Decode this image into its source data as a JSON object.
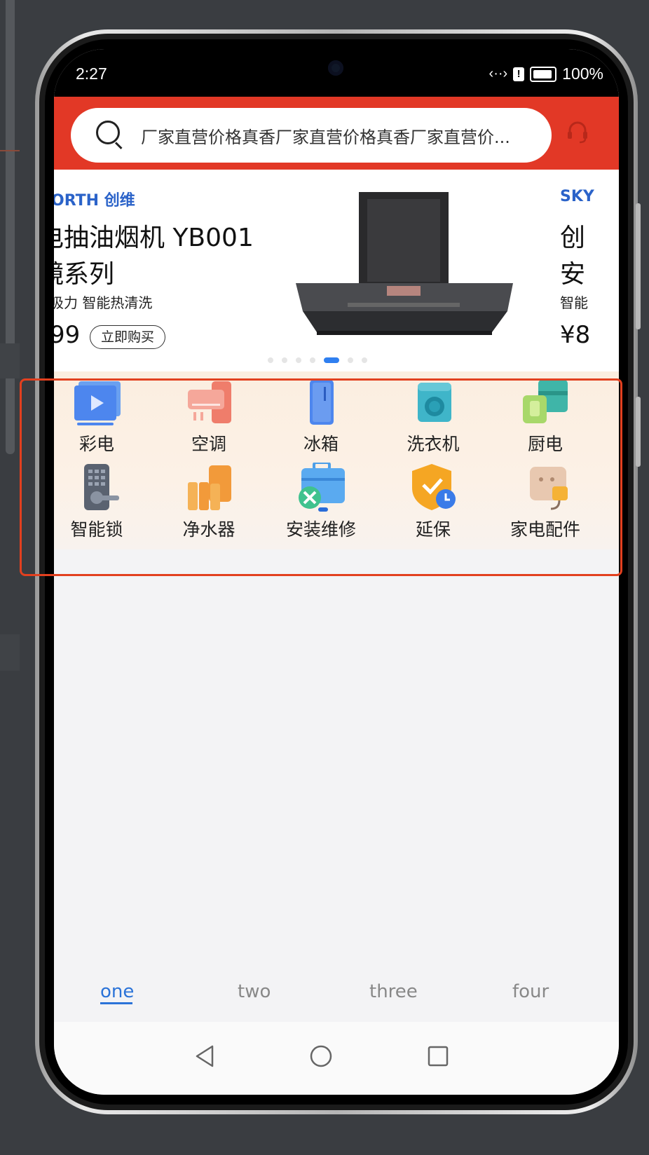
{
  "status_bar": {
    "time": "2:27",
    "battery": "100%"
  },
  "search": {
    "placeholder_text": "厂家直营价格真香厂家直营价格真香厂家直营价..."
  },
  "banner": {
    "left_brand": "ORTH 创维",
    "left_title_line1": "电抽油烟机 YB001",
    "left_title_line2": "镜系列",
    "left_subtitle": "吸力 智能热清洗",
    "left_price": "99",
    "buy_label": "立即购买",
    "right_brand": "SKY",
    "right_title_line1": "创",
    "right_title_line2": "安",
    "right_subtitle": "智能",
    "right_price": "¥8",
    "page_count": 7,
    "active_page": 4
  },
  "categories": [
    {
      "label": "彩电",
      "icon": "tv-icon"
    },
    {
      "label": "空调",
      "icon": "air-conditioner-icon"
    },
    {
      "label": "冰箱",
      "icon": "fridge-icon"
    },
    {
      "label": "洗衣机",
      "icon": "washing-machine-icon"
    },
    {
      "label": "厨电",
      "icon": "kitchen-appliance-icon"
    },
    {
      "label": "智能锁",
      "icon": "smart-lock-icon"
    },
    {
      "label": "净水器",
      "icon": "water-purifier-icon"
    },
    {
      "label": "安装维修",
      "icon": "install-repair-icon"
    },
    {
      "label": "延保",
      "icon": "extended-warranty-icon"
    },
    {
      "label": "家电配件",
      "icon": "accessories-icon"
    }
  ],
  "tabs": [
    {
      "label": "one",
      "active": true
    },
    {
      "label": "two",
      "active": false
    },
    {
      "label": "three",
      "active": false
    },
    {
      "label": "four",
      "active": false
    }
  ],
  "colors": {
    "header_red": "#e23826",
    "accent_blue": "#2b73d8",
    "highlight_red": "#e2401f"
  }
}
